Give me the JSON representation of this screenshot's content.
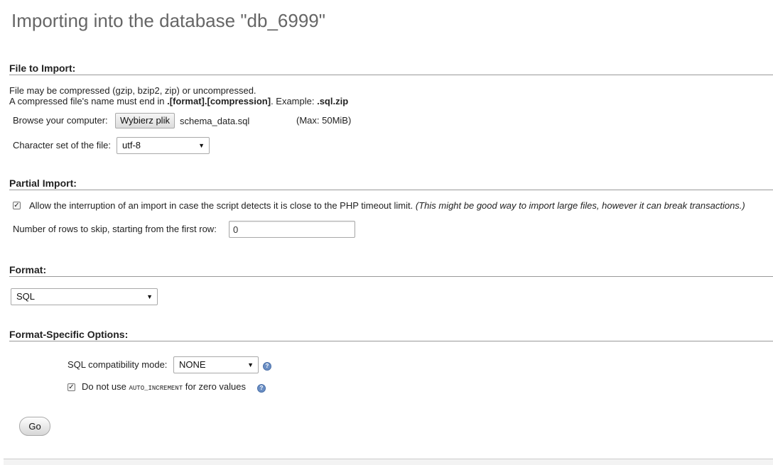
{
  "page": {
    "title": "Importing into the database \"db_6999\""
  },
  "file_section": {
    "title": "File to Import:",
    "desc_line1": "File may be compressed (gzip, bzip2, zip) or uncompressed.",
    "desc_line2_prefix": "A compressed file's name must end in ",
    "desc_line2_bold": ".[format].[compression]",
    "desc_line2_mid": ". Example: ",
    "desc_line2_example": ".sql.zip",
    "browse_label": "Browse your computer:",
    "browse_button": "Wybierz plik",
    "file_name": "schema_data.sql",
    "max_size": "(Max: 50MiB)",
    "charset_label": "Character set of the file:",
    "charset_value": "utf-8"
  },
  "partial_section": {
    "title": "Partial Import:",
    "allow_checked": true,
    "allow_label": "Allow the interruption of an import in case the script detects it is close to the PHP timeout limit.",
    "allow_note": "(This might be good way to import large files, however it can break transactions.)",
    "skip_label": "Number of rows to skip, starting from the first row:",
    "skip_value": "0"
  },
  "format_section": {
    "title": "Format:",
    "format_value": "SQL"
  },
  "options_section": {
    "title": "Format-Specific Options:",
    "compat_label": "SQL compatibility mode:",
    "compat_value": "NONE",
    "no_auto_checked": true,
    "no_auto_prefix": "Do not use ",
    "no_auto_code": "AUTO_INCREMENT",
    "no_auto_suffix": " for zero values"
  },
  "actions": {
    "go_label": "Go"
  },
  "icons": {
    "dropdown": "dropdown-arrow-icon",
    "help": "help-icon",
    "check": "checkmark-icon"
  },
  "colors": {
    "title": "#666666",
    "rule": "#999999",
    "help": "#6b8fc4"
  }
}
